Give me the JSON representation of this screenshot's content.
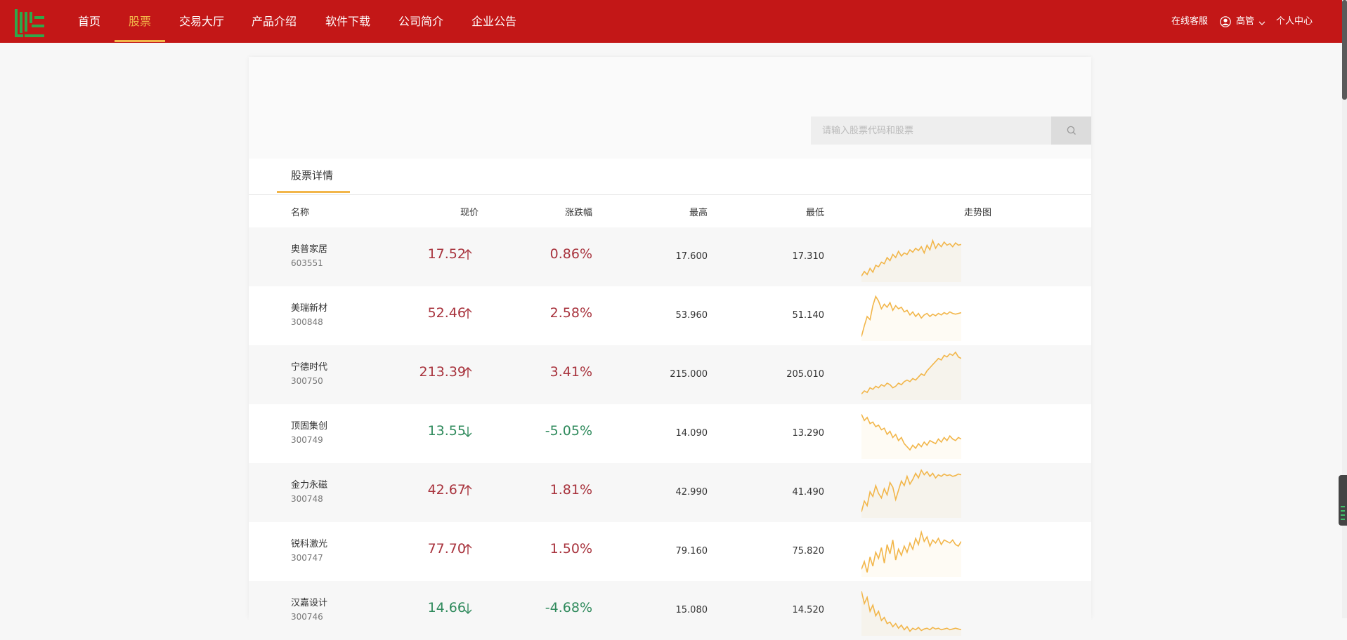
{
  "nav": {
    "items": [
      "首页",
      "股票",
      "交易大厅",
      "产品介绍",
      "软件下载",
      "公司简介",
      "企业公告"
    ],
    "active_index": 1
  },
  "header_right": {
    "service": "在线客服",
    "username": "高管",
    "personal_center": "个人中心"
  },
  "search": {
    "placeholder": "请输入股票代码和股票"
  },
  "tab": {
    "label": "股票详情"
  },
  "table": {
    "columns": [
      "名称",
      "现价",
      "涨跌幅",
      "最高",
      "最低",
      "走势图"
    ],
    "rows": [
      {
        "name": "奥普家居",
        "code": "603551",
        "price": "17.52",
        "direction": "up",
        "change": "0.86%",
        "high": "17.600",
        "low": "17.310",
        "trend": [
          6,
          12,
          8,
          16,
          11,
          20,
          18,
          24,
          22,
          30,
          26,
          34,
          30,
          38,
          32,
          36,
          34,
          40,
          37,
          42,
          39,
          44,
          36,
          46,
          40,
          52,
          42,
          48,
          44,
          50,
          46,
          48,
          44,
          49,
          46,
          47
        ]
      },
      {
        "name": "美瑞新材",
        "code": "300848",
        "price": "52.46",
        "direction": "up",
        "change": "2.58%",
        "high": "53.960",
        "low": "51.140",
        "trend": [
          4,
          18,
          30,
          26,
          44,
          56,
          50,
          40,
          46,
          42,
          48,
          38,
          44,
          40,
          42,
          36,
          38,
          32,
          36,
          30,
          34,
          28,
          32,
          34,
          30,
          33,
          31,
          34,
          32,
          35,
          33,
          36,
          34,
          33,
          34,
          35
        ]
      },
      {
        "name": "宁德时代",
        "code": "300750",
        "price": "213.39",
        "direction": "up",
        "change": "3.41%",
        "high": "215.000",
        "low": "205.010",
        "trend": [
          6,
          10,
          8,
          14,
          12,
          16,
          14,
          18,
          16,
          20,
          18,
          14,
          16,
          20,
          18,
          22,
          24,
          22,
          26,
          24,
          28,
          32,
          30,
          36,
          40,
          44,
          48,
          52,
          50,
          56,
          54,
          58,
          56,
          60,
          54,
          52
        ]
      },
      {
        "name": "顶固集创",
        "code": "300749",
        "price": "13.55",
        "direction": "down",
        "change": "-5.05%",
        "high": "14.090",
        "low": "13.290",
        "trend": [
          56,
          48,
          52,
          44,
          46,
          40,
          42,
          36,
          38,
          30,
          34,
          26,
          30,
          22,
          26,
          18,
          14,
          10,
          16,
          12,
          18,
          14,
          20,
          16,
          22,
          20,
          18,
          24,
          20,
          26,
          22,
          28,
          24,
          22,
          26,
          24
        ]
      },
      {
        "name": "金力永磁",
        "code": "300748",
        "price": "42.67",
        "direction": "up",
        "change": "1.81%",
        "high": "42.990",
        "low": "41.490",
        "trend": [
          6,
          20,
          14,
          32,
          26,
          40,
          30,
          24,
          36,
          28,
          44,
          38,
          22,
          34,
          46,
          40,
          52,
          42,
          48,
          56,
          50,
          60,
          54,
          58,
          52,
          56,
          50,
          54,
          52,
          55,
          53,
          54,
          52,
          53,
          55,
          54
        ]
      },
      {
        "name": "锐科激光",
        "code": "300747",
        "price": "77.70",
        "direction": "up",
        "change": "1.50%",
        "high": "79.160",
        "low": "75.820",
        "trend": [
          8,
          18,
          4,
          24,
          12,
          30,
          22,
          36,
          16,
          40,
          28,
          46,
          20,
          34,
          26,
          38,
          30,
          42,
          34,
          48,
          40,
          56,
          44,
          50,
          38,
          46,
          42,
          48,
          40,
          46,
          44,
          42,
          46,
          40,
          38,
          44
        ]
      },
      {
        "name": "汉嘉设计",
        "code": "300746",
        "price": "14.66",
        "direction": "down",
        "change": "-4.68%",
        "high": "15.080",
        "low": "14.520",
        "trend": [
          56,
          40,
          48,
          30,
          38,
          24,
          30,
          18,
          22,
          14,
          16,
          10,
          14,
          8,
          12,
          6,
          10,
          4,
          8,
          6,
          9,
          5,
          7,
          8,
          6,
          9,
          7,
          8,
          6,
          7,
          8,
          6,
          7,
          8,
          7,
          6
        ]
      }
    ]
  },
  "colors": {
    "brand_red": "#c31717",
    "accent_gold": "#f2b64a",
    "up_red": "#a8333d",
    "down_green": "#2f8a5c",
    "trend_line": "#f2b64a"
  }
}
